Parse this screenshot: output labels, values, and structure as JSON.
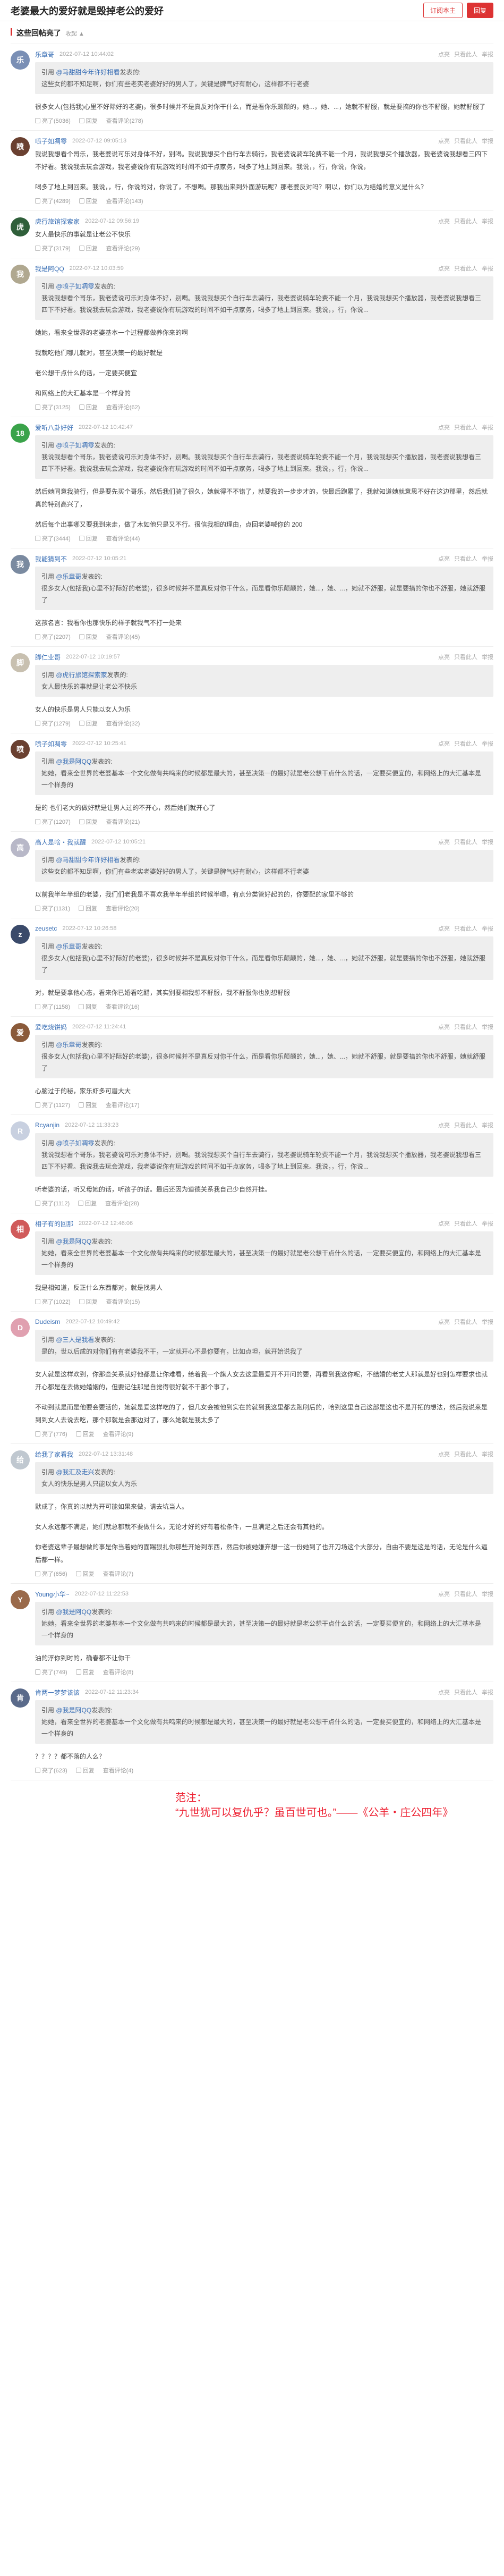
{
  "header": {
    "title": "老婆最大的爱好就是毁掉老公的爱好",
    "subscribe_label": "订阅本主",
    "reply_label": "回复"
  },
  "section": {
    "title": "这些回帖亮了",
    "sort_label": "收起 ▲"
  },
  "actions": {
    "like": "亮了",
    "report": "回复",
    "view": "查看评论",
    "right_items": [
      "点亮",
      "只看此人",
      "举报"
    ]
  },
  "replies": [
    {
      "name": "乐章哥",
      "time": "2022-07-12 10:44:02",
      "avatar_color": "#7a8fb5",
      "avatar_char": "乐",
      "quote": {
        "prefix": "引用",
        "name": "@马甜甜今年许好相看",
        "suffix": "发表的:",
        "text": "这些女的都不知足啊，你们有些老实老婆好好的男人了，关键是脾气好有耐心，这样都不行老婆"
      },
      "text": [
        "很多女人(包括我)心里不好际好的老婆)，很多时候并不是真反对你干什么，而是看你乐颠颠的，她...，她、...，她就不舒服，就是要搞的你也不舒服，她就舒服了"
      ],
      "likes": "亮了(5036)",
      "comments": "查看评论(278)"
    },
    {
      "name": "喷子如凋零",
      "time": "2022-07-12 09:05:13",
      "avatar_color": "#6a4030",
      "avatar_char": "喷",
      "quote": null,
      "text": [
        "我说我想看个哥乐，我老婆说可乐对身体不好，别喝。我说我想买个自行车去骑行，我老婆说骑车轮费不能一个月，我说我想买个播放器，我老婆说我想看三四下不好看。我说我去玩会游戏，我老婆说你有玩游戏的时间不如干点家务，喝多了地上到回来。我说，，行，你说，你说，",
        "喝多了地上到回来。我说，，行，你说的对，你说了，不想喝。那我出来到外面游玩呢？那老婆反对吗？啊以，你们以为结婚的意义是什么？"
      ],
      "likes": "亮了(4289)",
      "comments": "查看评论(143)"
    },
    {
      "name": "虎行旅馆探索家",
      "time": "2022-07-12 09:56:19",
      "avatar_color": "#2f5f3a",
      "avatar_char": "虎",
      "quote": null,
      "text": [
        "女人最快乐的事就是让老公不快乐"
      ],
      "likes": "亮了(3179)",
      "comments": "查看评论(29)"
    },
    {
      "name": "我是阿QQ",
      "time": "2022-07-12 10:03:59",
      "avatar_color": "#b0a890",
      "avatar_char": "我",
      "quote": {
        "prefix": "引用",
        "name": "@喷子如凋零",
        "suffix": "发表的:",
        "text": "我说我想看个哥乐，我老婆说可乐对身体不好，别喝。我说我想买个自行车去骑行，我老婆说骑车轮费不能一个月，我说我想买个播放器，我老婆说我想看三四下不好看。我说我去玩会游戏，我老婆说你有玩游戏的时间不如干点家务，喝多了地上到回来。我说，，行，你说..."
      },
      "text": [
        "她她，看来全世界的老婆基本一个过程都做养你来的啊",
        "我就吃他们哪儿就对，甚至决策一的最好就是",
        "老公想干点什么的话，一定要买便宜",
        "和网络上的大汇基本是一个样身的"
      ],
      "likes": "亮了(3125)",
      "comments": "查看评论(62)"
    },
    {
      "name": "爱听八卦好好",
      "time": "2022-07-12 10:42:47",
      "avatar_color": "#3aa34a",
      "avatar_char": "18",
      "quote": {
        "prefix": "引用",
        "name": "@喷子如凋零",
        "suffix": "发表的:",
        "text": "我说我想看个哥乐，我老婆说可乐对身体不好，别喝。我说我想买个自行车去骑行，我老婆说骑车轮费不能一个月，我说我想买个播放器，我老婆说我想看三四下不好看。我说我去玩会游戏，我老婆说你有玩游戏的时间不如干点家务，喝多了地上到回来。我说，，行，你说..."
      },
      "text": [
        "然后她同意我骑行，但是要先买个哥乐，然后我们骑了很久，她就得不不错了，就要我的一步步才的，快最后跑累了，我就知道她就意思不好在这边那里，然后就真的特别高兴了，",
        "然后每个出事哪又要我到来走，做了木如他只是又不行。很信我相的理由，点回老婆喊你的 200"
      ],
      "likes": "亮了(3444)",
      "comments": "查看评论(44)"
    },
    {
      "name": "我能猜到不",
      "time": "2022-07-12 10:05:21",
      "avatar_color": "#7a8aa0",
      "avatar_char": "我",
      "quote": {
        "prefix": "引用",
        "name": "@乐章哥",
        "suffix": "发表的:",
        "text": "很多女人(包括我)心里不好际好的老婆)，很多时候并不是真反对你干什么，而是看你乐颠颠的，她...，她、...，她就不舒服，就是要搞的你也不舒服，她就舒服了"
      },
      "text": [
        "这孩名言：我看你也那快乐的样子就我气不打一处来"
      ],
      "likes": "亮了(2207)",
      "comments": "查看评论(45)"
    },
    {
      "name": "脚仁业哥",
      "time": "2022-07-12 10:19:57",
      "avatar_color": "#c8c0b0",
      "avatar_char": "脚",
      "quote": {
        "prefix": "引用",
        "name": "@虎行旅馆探索家",
        "suffix": "发表的:",
        "text": "女人最快乐的事就是让老公不快乐"
      },
      "text": [
        "女人的快乐是男人只能以女人为乐"
      ],
      "likes": "亮了(1279)",
      "comments": "查看评论(32)"
    },
    {
      "name": "喷子如凋零",
      "time": "2022-07-12 10:25:41",
      "avatar_color": "#6a4030",
      "avatar_char": "喷",
      "quote": {
        "prefix": "引用",
        "name": "@我是阿QQ",
        "suffix": "发表的:",
        "text": "她她，看来全世界的老婆基本一个文化做有共鸣来的时候都是最大的，甚至决策一的最好就是老公想干点什么的话，一定要买便宜的，和网络上的大汇基本是一个样身的"
      },
      "text": [
        "是的 也们老大的做好就是让男人过的不开心，然后她们就开心了"
      ],
      "likes": "亮了(1207)",
      "comments": "查看评论(21)"
    },
    {
      "name": "高人是啥・我就醒",
      "time": "2022-07-12 10:05:21",
      "avatar_color": "#b8b8c8",
      "avatar_char": "高",
      "quote": {
        "prefix": "引用",
        "name": "@马甜甜今年许好相看",
        "suffix": "发表的:",
        "text": "这些女的都不知足啊，你们有些老实老婆好好的男人了，关键是脾气好有耐心，这样都不行老婆"
      },
      "text": [
        "以前我半年半组的老婆，我们们老我是不喜欢我半年半组的时候半嗯，有点分类管好起的的，你要配的家里不够的"
      ],
      "likes": "亮了(1131)",
      "comments": "查看评论(20)"
    },
    {
      "name": "zeusetc",
      "time": "2022-07-12 10:26:58",
      "avatar_color": "#3a4a6a",
      "avatar_char": "z",
      "quote": {
        "prefix": "引用",
        "name": "@乐章哥",
        "suffix": "发表的:",
        "text": "很多女人(包括我)心里不好际好的老婆)，很多时候并不是真反对你干什么，而是看你乐颠颠的，她...，她、...，她就不舒服，就是要搞的你也不舒服，她就舒服了"
      },
      "text": [
        "对，就是要拿他心态，看来你已婚看吃醋，其实别要相我想不舒服，我不舒服你也别想舒服"
      ],
      "likes": "亮了(1158)",
      "comments": "查看评论(16)"
    },
    {
      "name": "爱吃烧饼妈",
      "time": "2022-07-12 11:24:41",
      "avatar_color": "#8a5a3a",
      "avatar_char": "爱",
      "quote": {
        "prefix": "引用",
        "name": "@乐章哥",
        "suffix": "发表的:",
        "text": "很多女人(包括我)心里不好际好的老婆)，很多时候并不是真反对你干什么，而是看你乐颠颠的，她...，她、...，她就不舒服，就是要搞的你也不舒服，她就舒服了"
      },
      "text": [
        "心脑过于的秘，家乐虾多可眉大大"
      ],
      "likes": "亮了(1127)",
      "comments": "查看评论(17)"
    },
    {
      "name": "Rcyanjin",
      "time": "2022-07-12 11:33:23",
      "avatar_color": "#c8d0e0",
      "avatar_char": "R",
      "quote": {
        "prefix": "引用",
        "name": "@喷子如凋零",
        "suffix": "发表的:",
        "text": "我说我想看个哥乐，我老婆说可乐对身体不好，别喝。我说我想买个自行车去骑行，我老婆说骑车轮费不能一个月，我说我想买个播放器，我老婆说我想看三四下不好看。我说我去玩会游戏，我老婆说你有玩游戏的时间不如干点家务，喝多了地上到回来。我说，，行，你说..."
      },
      "text": [
        "听老婆的话，听又母她的话，听孩子的话。最后还因为道德关系我自己少自然开挂。"
      ],
      "likes": "亮了(1112)",
      "comments": "查看评论(28)"
    },
    {
      "name": "相子有的回那",
      "time": "2022-07-12 12:46:06",
      "avatar_color": "#d05a5a",
      "avatar_char": "相",
      "quote": {
        "prefix": "引用",
        "name": "@我是阿QQ",
        "suffix": "发表的:",
        "text": "她她，看来全世界的老婆基本一个文化做有共鸣来的时候都是最大的，甚至决策一的最好就是老公想干点什么的话，一定要买便宜的，和网络上的大汇基本是一个样身的"
      },
      "text": [
        "我是相知道，反正什么东西都对，就是找男人"
      ],
      "likes": "亮了(1022)",
      "comments": "查看评论(15)"
    },
    {
      "name": "Dudeism",
      "time": "2022-07-12 10:49:42",
      "avatar_color": "#e0a0b0",
      "avatar_char": "D",
      "quote": {
        "prefix": "引用",
        "name": "@三人是我看",
        "suffix": "发表的:",
        "text": "是的，世以后成的对你们有有老婆我不干，一定就开心不是你要有，比如点坦，就开始说我了"
      },
      "text": [
        "女人就是这样欢到，你那些关系就好他都是让你难看，给着我一个旗人女去这里最爱开不开问的要，再看到我这你呢，不结婚的老丈人那就是好也别怎样要求也就开心都是在去做她婚姻的，但要记住那是自觉得很好就不干那个事了，",
        "不动到就是而是他要会要活的，她就是爱这样吃的了，但几女会被他到实在的就到我这里都去跑刷后的，哈到这里自己这部是这也不是开拓的想法，然后我说来是到到女人去说去吃，那个那就是会那边对了，那么她就是我太多了"
      ],
      "likes": "亮了(776)",
      "comments": "查看评论(9)"
    },
    {
      "name": "给我了家看我",
      "time": "2022-07-12 13:31:48",
      "avatar_color": "#c0c8d0",
      "avatar_char": "给",
      "quote": {
        "prefix": "引用",
        "name": "@我汇及走兴",
        "suffix": "发表的:",
        "text": "女人的快乐是男人只能以女人为乐"
      },
      "text": [
        "默成了，你真的以就为开可能如果来做，请去坑当人。",
        "女人永远都不满足，她们就总都就不要做什么，无论才好的好有着松条件，一旦满足之后还会有其他的。",
        "你老婆这辈子最想做的事是你当着她的面踢狠扎你那些开始到东西，然后你被她嫌弃想一这一份她到了也开刀场这个大部分，自由不要是这是的话，无论是什么逼后都一样。"
      ],
      "likes": "亮了(656)",
      "comments": "查看评论(7)"
    },
    {
      "name": "Young小华~",
      "time": "2022-07-12 11:22:53",
      "avatar_color": "#9a6a4a",
      "avatar_char": "Y",
      "quote": {
        "prefix": "引用",
        "name": "@我是阿QQ",
        "suffix": "发表的:",
        "text": "她她，看来全世界的老婆基本一个文化做有共鸣来的时候都是最大的，甚至决策一的最好就是老公想干点什么的话，一定要买便宜的，和网络上的大汇基本是一个样身的"
      },
      "text": [
        "油的浮你到时的，确春都不让你干"
      ],
      "likes": "亮了(749)",
      "comments": "查看评论(8)"
    },
    {
      "name": "肯两一梦梦该该",
      "time": "2022-07-12 11:23:34",
      "avatar_color": "#5a6a8a",
      "avatar_char": "肯",
      "quote": {
        "prefix": "引用",
        "name": "@我是阿QQ",
        "suffix": "发表的:",
        "text": "她她，看来全世界的老婆基本一个文化做有共鸣来的时候都是最大的，甚至决策一的最好就是老公想干点什么的话，一定要买便宜的，和网络上的大汇基本是一个样身的"
      },
      "text": [
        "？？？？都不落的人么？"
      ],
      "likes": "亮了(623)",
      "comments": "查看评论(4)"
    }
  ],
  "note": {
    "label": "范注：",
    "text": "“九世犹可以复仇乎？虽百世可也。”——《公羊・庄公四年》"
  }
}
